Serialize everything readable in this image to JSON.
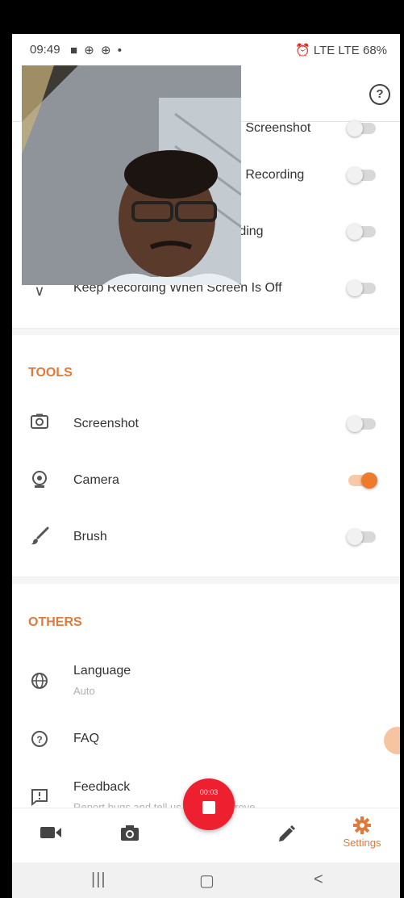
{
  "status_bar": {
    "time": "09:49",
    "icons_left": "■ ⊕ ⊕ •",
    "icons_right": "⏰ LTE LTE 68%"
  },
  "header": {
    "help": "?"
  },
  "settings_partial": [
    {
      "label": "g Screenshot",
      "toggle_on": false
    },
    {
      "label": "g Recording",
      "toggle_on": false
    },
    {
      "label": "rding",
      "toggle_on": false
    },
    {
      "label": "Keep Recording When Screen Is Off",
      "toggle_on": false
    }
  ],
  "tools": {
    "title": "TOOLS",
    "items": [
      {
        "label": "Screenshot",
        "icon": "screenshot-icon",
        "toggle_on": false
      },
      {
        "label": "Camera",
        "icon": "camera-icon",
        "toggle_on": true
      },
      {
        "label": "Brush",
        "icon": "brush-icon",
        "toggle_on": false
      }
    ]
  },
  "others": {
    "title": "OTHERS",
    "items": [
      {
        "label": "Language",
        "sub": "Auto",
        "icon": "globe-icon"
      },
      {
        "label": "FAQ",
        "icon": "help-icon"
      },
      {
        "label": "Feedback",
        "sub": "Report bugs and tell us how to improve",
        "icon": "feedback-icon"
      }
    ]
  },
  "record": {
    "timer": "00:03"
  },
  "bottom_nav": {
    "tabs": [
      {
        "name": "video",
        "icon": "video-icon"
      },
      {
        "name": "photo",
        "icon": "camera-icon"
      },
      {
        "name": "brush",
        "icon": "pencil-icon"
      },
      {
        "name": "settings",
        "label": "Settings",
        "icon": "gear-icon"
      }
    ]
  },
  "system_nav": {
    "recents": "|||",
    "home": "▢",
    "back": "<"
  },
  "colors": {
    "accent": "#e07a3c",
    "record_red": "#ee2030"
  }
}
